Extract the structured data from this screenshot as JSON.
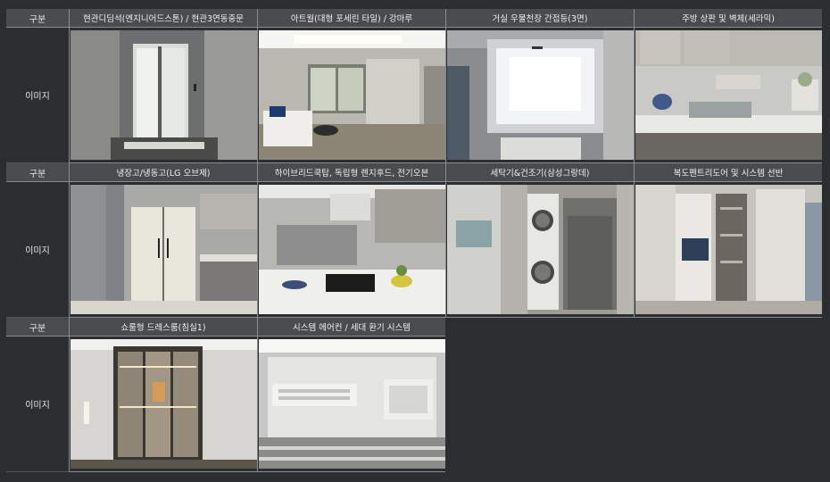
{
  "table": {
    "label_header": "구분",
    "label_image": "이미지",
    "rows": [
      {
        "headers": [
          "현관디딤석(엔지니어드스톤) / 현관3연동중문",
          "아트월(대형 포세린 타일) / 강마루",
          "거실 우물천장 간접등(3면)",
          "주방 상판 및 벽체(세라믹)"
        ]
      },
      {
        "headers": [
          "냉장고/냉동고(LG 오브제)",
          "하이브리드쿡탑, 독립형 렌지후드, 전기오븐",
          "세탁기&건조기(삼성그랑데)",
          "복도펜트리도어 및 시스템 선반"
        ]
      },
      {
        "headers": [
          "쇼룸형 드레스룸(침실1)",
          "시스템 에어컨 / 세대 환기 시스템"
        ]
      }
    ]
  }
}
